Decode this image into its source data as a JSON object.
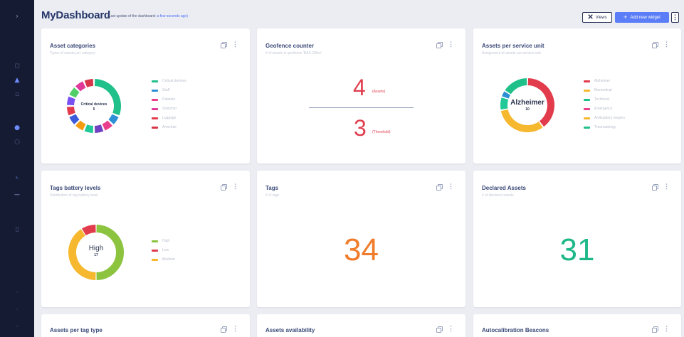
{
  "header": {
    "title": "MyDashboard",
    "subtitle": "(Last update of the dashboard:",
    "subtitle_link": "a few seconds ago)",
    "views_label": "Views",
    "add_widget_label": "Add new widget",
    "more_label": "⋮"
  },
  "sidebar": {
    "items": [
      {
        "icon": "expand-icon",
        "active": false
      },
      {
        "icon": "home-icon",
        "active": false
      },
      {
        "icon": "users-icon",
        "active": true
      },
      {
        "icon": "tag-icon",
        "active": false
      },
      {
        "icon": "location-icon",
        "active": false
      },
      {
        "icon": "settings-icon",
        "active": false
      },
      {
        "icon": "chart-line-icon",
        "active": true
      },
      {
        "icon": "chart-bar-icon",
        "active": false
      },
      {
        "icon": "database-icon",
        "active": false
      },
      {
        "icon": "info-icon",
        "active": false
      },
      {
        "icon": "help-icon",
        "active": false
      }
    ]
  },
  "widgets": {
    "asset_categories": {
      "title": "Asset categories",
      "subtitle": "Types of assets per category",
      "center_label": "Critical devices",
      "center_value": "5",
      "legend": [
        {
          "label": "Critical devices",
          "color": "#1fc08a"
        },
        {
          "label": "Staff",
          "color": "#2d8fd5"
        },
        {
          "label": "Patients",
          "color": "#e83e8c"
        },
        {
          "label": "Stretcher",
          "color": "#e0399a"
        },
        {
          "label": "Luggage",
          "color": "#e23b4b"
        },
        {
          "label": "Armchair",
          "color": "#d8344a"
        }
      ],
      "segments": [
        {
          "color": "#1fc08a",
          "value": 5
        },
        {
          "color": "#2d8fd5",
          "value": 1
        },
        {
          "color": "#e83e8c",
          "value": 1
        },
        {
          "color": "#6f42c1",
          "value": 1
        },
        {
          "color": "#20c997",
          "value": 1
        },
        {
          "color": "#f39c12",
          "value": 1
        },
        {
          "color": "#3b5bdb",
          "value": 1
        },
        {
          "color": "#e23b4b",
          "value": 1
        },
        {
          "color": "#7950f2",
          "value": 1
        },
        {
          "color": "#51cf66",
          "value": 1
        },
        {
          "color": "#e0399a",
          "value": 1
        },
        {
          "color": "#d8344a",
          "value": 1
        }
      ]
    },
    "geofence": {
      "title": "Geofence counter",
      "subtitle": "# of assets in geofence 'BAS Office'",
      "assets_value": "4",
      "assets_label": "(Assets)",
      "threshold_value": "3",
      "threshold_label": "(Threshold)",
      "color": "#e03e4e"
    },
    "assets_service": {
      "title": "Assets per service unit",
      "subtitle": "Assignment of assets per service unit",
      "center_label": "Alzheimer",
      "center_value": "10",
      "legend": [
        {
          "label": "Alzheimer",
          "color": "#e23b4b"
        },
        {
          "label": "Biomedical",
          "color": "#f5b82e"
        },
        {
          "label": "Technical",
          "color": "#1fc08a"
        },
        {
          "label": "Emergency",
          "color": "#e83e8c"
        },
        {
          "label": "Ambulatory surgery",
          "color": "#f5b82e"
        },
        {
          "label": "Traumatology",
          "color": "#1fc08a"
        }
      ],
      "segments": [
        {
          "color": "#e23b4b",
          "value": 10
        },
        {
          "color": "#f5b82e",
          "value": 8
        },
        {
          "color": "#20c997",
          "value": 2
        },
        {
          "color": "#2d8fd5",
          "value": 1
        },
        {
          "color": "#1fc08a",
          "value": 4
        }
      ]
    },
    "tags_battery": {
      "title": "Tags battery levels",
      "subtitle": "Distribution of tag battery level",
      "center_label": "High",
      "center_value": "17",
      "legend": [
        {
          "label": "High",
          "color": "#8cc43f"
        },
        {
          "label": "Low",
          "color": "#e23b4b"
        },
        {
          "label": "Medium",
          "color": "#f5b82e"
        }
      ],
      "segments": [
        {
          "color": "#8cc43f",
          "value": 17
        },
        {
          "color": "#f5b82e",
          "value": 14
        },
        {
          "color": "#e23b4b",
          "value": 3
        }
      ]
    },
    "tags": {
      "title": "Tags",
      "subtitle": "# of tags",
      "value": "34",
      "color": "#f07c2c"
    },
    "declared_assets": {
      "title": "Declared Assets",
      "subtitle": "# of declared assets",
      "value": "31",
      "color": "#1fb889"
    },
    "assets_tag_type": {
      "title": "Assets per tag type"
    },
    "assets_availability": {
      "title": "Assets availability"
    },
    "autocalibration": {
      "title": "Autocalibration Beacons"
    }
  }
}
